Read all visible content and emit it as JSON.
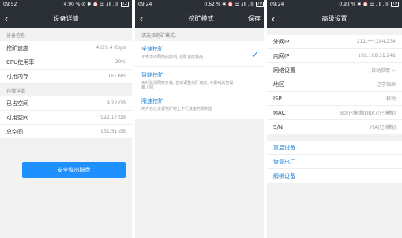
{
  "screen1": {
    "status": {
      "time": "09:52",
      "info": "4.90 % ✆ ✱ ⏰ ☰ .ıll .ıll",
      "battery": "72"
    },
    "title": "设备详情",
    "sec1": "设备信息",
    "rows1": [
      {
        "label": "挖矿速度",
        "value": "4629.4 Kbps"
      },
      {
        "label": "CPU使用率",
        "value": "20%"
      },
      {
        "label": "可用内存",
        "value": "161 MB"
      }
    ],
    "sec2": "存储详情",
    "rows2": [
      {
        "label": "已占空间",
        "value": "9.22 GB"
      },
      {
        "label": "可用空间",
        "value": "922.17 GB"
      },
      {
        "label": "总空间",
        "value": "931.51 GB"
      }
    ],
    "button": "安全弹出磁盘"
  },
  "screen2": {
    "status": {
      "time": "09:24",
      "info": "0.62 % ✱ ⏰ ☰ .ıll .ıll",
      "battery": "79"
    },
    "title": "挖矿模式",
    "save": "保存",
    "prompt": "请选择挖矿模式:",
    "modes": [
      {
        "title": "全速挖矿",
        "desc": "不考虑对网络的影响, 挖矿速度最高"
      },
      {
        "title": "智能挖矿",
        "desc": "实时监测网络负载, 自动调整挖矿速度, 不影响其他设备上网"
      },
      {
        "title": "限速挖矿",
        "desc": "用户自己设置挖矿时上下行速度的限制值"
      }
    ]
  },
  "screen3": {
    "status": {
      "time": "09:24",
      "info": "0.93 % ✱ ⏰ ☰ .ıll .ıll",
      "battery": "79"
    },
    "title": "高级设置",
    "rows": [
      {
        "label": "外网IP",
        "value": "211.***.284.234"
      },
      {
        "label": "内网IP",
        "value": "192.168.31.242"
      },
      {
        "label": "网络设置",
        "value": "自动获取 >"
      },
      {
        "label": "地区",
        "value": "辽宁锦州"
      },
      {
        "label": "ISP",
        "value": "移动"
      },
      {
        "label": "MAC",
        "value": "B0[已模糊]DBA7[已模糊]"
      },
      {
        "label": "S/N",
        "value": "YFA[已模糊]"
      }
    ],
    "links": [
      "重启设备",
      "恢复出厂",
      "解绑设备"
    ]
  }
}
